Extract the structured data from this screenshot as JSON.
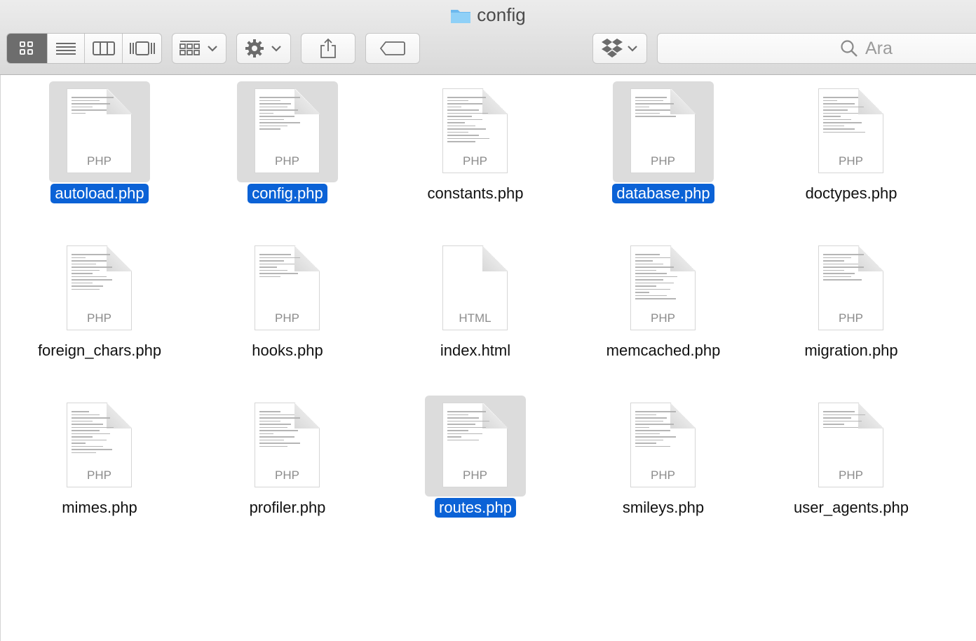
{
  "window": {
    "title": "config",
    "folder_icon": "folder-icon"
  },
  "toolbar": {
    "view_buttons": [
      {
        "name": "icon-view-button",
        "icon": "grid-icon",
        "active": true
      },
      {
        "name": "list-view-button",
        "icon": "list-icon",
        "active": false
      },
      {
        "name": "column-view-button",
        "icon": "columns-icon",
        "active": false
      },
      {
        "name": "gallery-view-button",
        "icon": "coverflow-icon",
        "active": false
      }
    ],
    "arrange_icon": "arrange-grid-icon",
    "action_icon": "gear-icon",
    "share_icon": "share-icon",
    "tag_icon": "tag-icon",
    "dropbox_icon": "dropbox-icon",
    "search": {
      "placeholder": "Ara",
      "icon": "search-icon"
    }
  },
  "files": [
    {
      "name": "autoload.php",
      "ext": "PHP",
      "selected": true
    },
    {
      "name": "config.php",
      "ext": "PHP",
      "selected": true
    },
    {
      "name": "constants.php",
      "ext": "PHP",
      "selected": false
    },
    {
      "name": "database.php",
      "ext": "PHP",
      "selected": true
    },
    {
      "name": "doctypes.php",
      "ext": "PHP",
      "selected": false
    },
    {
      "name": "foreign_chars.php",
      "ext": "PHP",
      "selected": false
    },
    {
      "name": "hooks.php",
      "ext": "PHP",
      "selected": false
    },
    {
      "name": "index.html",
      "ext": "HTML",
      "selected": false
    },
    {
      "name": "memcached.php",
      "ext": "PHP",
      "selected": false
    },
    {
      "name": "migration.php",
      "ext": "PHP",
      "selected": false
    },
    {
      "name": "mimes.php",
      "ext": "PHP",
      "selected": false
    },
    {
      "name": "profiler.php",
      "ext": "PHP",
      "selected": false
    },
    {
      "name": "routes.php",
      "ext": "PHP",
      "selected": true
    },
    {
      "name": "smileys.php",
      "ext": "PHP",
      "selected": false
    },
    {
      "name": "user_agents.php",
      "ext": "PHP",
      "selected": false
    }
  ],
  "colors": {
    "selection": "#0b62d6",
    "toolbar": "#dcdcdc"
  }
}
